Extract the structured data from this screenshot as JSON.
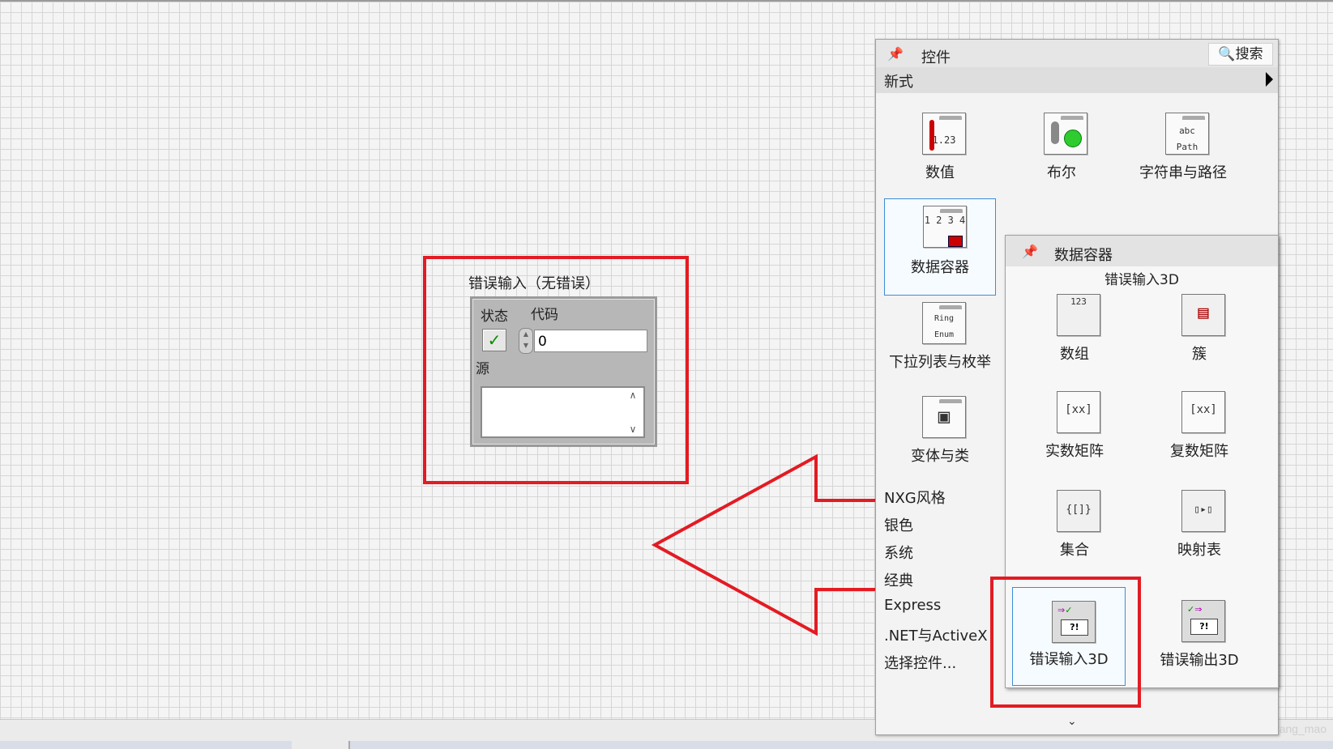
{
  "front_panel": {
    "error_cluster": {
      "label": "错误输入（无错误）",
      "status_label": "状态",
      "code_label": "代码",
      "code_value": "0",
      "status_mark": "✓",
      "source_label": "源"
    }
  },
  "palette": {
    "title": "控件",
    "search_label": "搜索",
    "section": "新式",
    "items": [
      {
        "label": "数值",
        "glyph": "1.23"
      },
      {
        "label": "布尔",
        "glyph": "●"
      },
      {
        "label": "字符串与路径",
        "glyph": "abc Path"
      },
      {
        "label": "数据容器",
        "glyph": "1 2 3 4"
      },
      {
        "label": "下拉列表与枚举",
        "glyph": "Ring Enum"
      },
      {
        "label": "变体与类",
        "glyph": "▣"
      }
    ],
    "categories": [
      "NXG风格",
      "银色",
      "系统",
      "经典",
      "Express",
      ".NET与ActiveX",
      "选择控件..."
    ],
    "more_chevron": "⌄"
  },
  "subpalette": {
    "title": "数据容器",
    "tooltip": "错误输入3D",
    "items": [
      {
        "label": "数组",
        "glyph": "123"
      },
      {
        "label": "簇",
        "glyph": "▤"
      },
      {
        "label": "实数矩阵",
        "glyph": "[xx]"
      },
      {
        "label": "复数矩阵",
        "glyph": "[xx]"
      },
      {
        "label": "集合",
        "glyph": "{[]}"
      },
      {
        "label": "映射表",
        "glyph": "▯▸▯"
      },
      {
        "label": "错误输入3D",
        "glyph": "?!"
      },
      {
        "label": "错误输出3D",
        "glyph": "?!"
      }
    ]
  },
  "watermark": "https://blog.csdn.net/ba_wang_mao",
  "colors": {
    "highlight": "#e31b23",
    "selection": "#3a8ed6"
  }
}
